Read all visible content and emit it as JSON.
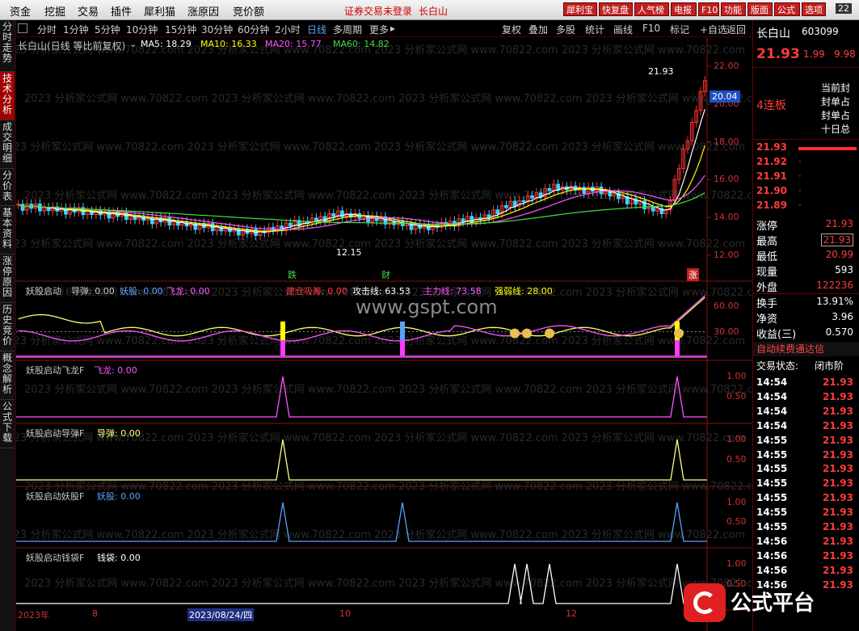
{
  "menu": [
    "资金",
    "挖掘",
    "交易",
    "插件",
    "犀利猫",
    "涨原因",
    "竞价额"
  ],
  "notice": "证券交易未登录",
  "notice_stock": "长白山",
  "top_buttons": [
    "犀利宝",
    "快复盘",
    "人气榜",
    "电报",
    "F10",
    "功能",
    "版面",
    "公式",
    "选项"
  ],
  "top_time": "22",
  "periods": [
    "分时",
    "1分钟",
    "5分钟",
    "10分钟",
    "15分钟",
    "30分钟",
    "60分钟",
    "2小时",
    "日线",
    "多周期",
    "更多"
  ],
  "active_period": "日线",
  "tools": [
    "复权",
    "叠加",
    "多股",
    "统计",
    "画线",
    "F10",
    "标记",
    "+自选",
    "返回"
  ],
  "left_tabs": [
    "分时走势",
    "技术分析",
    "成交明细",
    "分价表",
    "基本资料",
    "涨停原因",
    "历史竞价",
    "概念解析",
    "公式下载"
  ],
  "main": {
    "title": "长白山(日线 等比前复权)",
    "ma": [
      {
        "label": "MA5: 18.29",
        "color": "#ffffff"
      },
      {
        "label": "MA10: 16.33",
        "color": "#ffff00"
      },
      {
        "label": "MA20: 15.77",
        "color": "#ff55ff"
      },
      {
        "label": "MA60: 14.82",
        "color": "#44dd44"
      }
    ],
    "high_label": "21.93",
    "low_label": "12.15",
    "price_marker": "20.04",
    "events": [
      "跌",
      "财",
      "涨"
    ],
    "y_ticks": [
      "22.00",
      "20.00",
      "18.00",
      "16.00",
      "14.00",
      "12.00"
    ]
  },
  "indicator1": {
    "title": "妖股启动",
    "items": [
      {
        "label": "导弹: 0.00",
        "color": "#c8c8c8"
      },
      {
        "label": "妖股: 0.00",
        "color": "#5aa0ff"
      },
      {
        "label": "飞龙: 0.00",
        "color": "#ff55ff"
      },
      {
        "label": "建仓吸筹: 0.00",
        "color": "#ff3b3b"
      },
      {
        "label": "攻击线: 63.53",
        "color": "#ffffff"
      },
      {
        "label": "主力线: 73.58",
        "color": "#ff55ff"
      },
      {
        "label": "强弱线: 28.00",
        "color": "#ffff00"
      }
    ],
    "y_ticks": [
      "60.00",
      "30.00"
    ]
  },
  "panels": [
    {
      "title": "妖股启动飞龙F",
      "value": "飞龙: 0.00",
      "color": "#ff55ff",
      "ticks": [
        "1.00",
        "0.50"
      ],
      "peaks": [
        330,
        818
      ]
    },
    {
      "title": "妖股启动导弹F",
      "value": "导弹: 0.00",
      "color": "#ffff88",
      "ticks": [
        "1.00",
        "0.50"
      ],
      "peaks": [
        330,
        818
      ]
    },
    {
      "title": "妖股启动妖股F",
      "value": "妖股: 0.00",
      "color": "#5aa0ff",
      "ticks": [
        "1.00",
        "0.50"
      ],
      "peaks": [
        330,
        478,
        818
      ]
    },
    {
      "title": "妖股启动钱袋F",
      "value": "钱袋: 0.00",
      "color": "#ffffff",
      "ticks": [
        "1.00",
        "0.50"
      ],
      "peaks": [
        617,
        632,
        660,
        818
      ]
    }
  ],
  "watermark": "www.gspt.com",
  "bg_watermark": "2023 分析家公式网 www.70822.com",
  "date_bar": {
    "year": "2023年",
    "m8": "8",
    "date": "2023/08/24/四",
    "m10": "10",
    "m12": "12"
  },
  "right": {
    "name": "长白山",
    "code": "603099",
    "price": "21.93",
    "change": "1.99",
    "pct": "9.98",
    "board": "4连板",
    "tags": [
      "当前封",
      "封单占",
      "封单占",
      "十日总"
    ],
    "book": [
      {
        "price": "21.93",
        "val": ""
      },
      {
        "price": "21.92",
        "val": "·"
      },
      {
        "price": "21.91",
        "val": "·"
      },
      {
        "price": "21.90",
        "val": "·"
      },
      {
        "price": "21.89",
        "val": "·"
      }
    ],
    "stats": [
      {
        "label": "涨停",
        "value": "21.93",
        "color": "#ff3b3b"
      },
      {
        "label": "最高",
        "value": "21.93",
        "color": "#ff3b3b"
      },
      {
        "label": "最低",
        "value": "20.99",
        "color": "#ff3b3b"
      },
      {
        "label": "现量",
        "value": "593",
        "color": "#ffffff"
      },
      {
        "label": "外盘",
        "value": "122236",
        "color": "#ff3b3b"
      },
      {
        "label": "换手",
        "value": "13.91%",
        "color": "#ffffff"
      },
      {
        "label": "净资",
        "value": "3.96",
        "color": "#ffffff"
      },
      {
        "label": "收益(三)",
        "value": "0.570",
        "color": "#ffffff"
      }
    ],
    "scroll_text": "自动续费通达信",
    "status_label": "交易状态:",
    "status_value": "闭市阶",
    "ticks": [
      {
        "t": "14:54",
        "p": "21.93"
      },
      {
        "t": "14:54",
        "p": "21.93"
      },
      {
        "t": "14:54",
        "p": "21.93"
      },
      {
        "t": "14:54",
        "p": "21.93"
      },
      {
        "t": "14:55",
        "p": "21.93"
      },
      {
        "t": "14:55",
        "p": "21.93"
      },
      {
        "t": "14:55",
        "p": "21.93"
      },
      {
        "t": "14:55",
        "p": "21.93"
      },
      {
        "t": "14:55",
        "p": "21.93"
      },
      {
        "t": "14:55",
        "p": "21.93"
      },
      {
        "t": "14:55",
        "p": "21.93"
      },
      {
        "t": "14:56",
        "p": "21.93"
      },
      {
        "t": "14:56",
        "p": "21.93"
      },
      {
        "t": "14:56",
        "p": "21.93"
      },
      {
        "t": "14:56",
        "p": "21.93"
      }
    ]
  },
  "logo_text": "公式平台"
}
